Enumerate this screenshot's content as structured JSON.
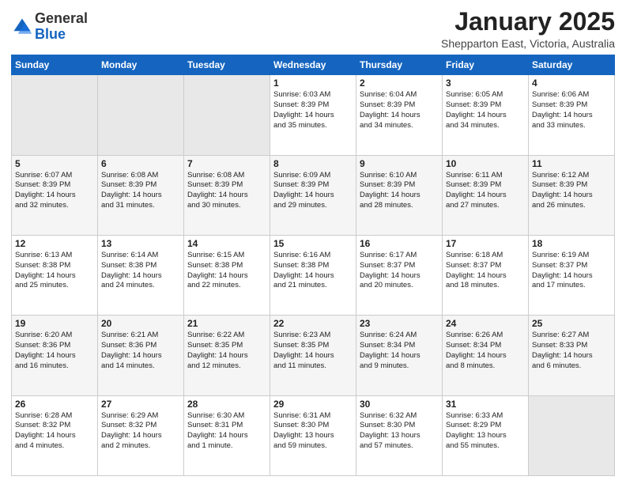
{
  "logo": {
    "general": "General",
    "blue": "Blue"
  },
  "header": {
    "month": "January 2025",
    "location": "Shepparton East, Victoria, Australia"
  },
  "days_of_week": [
    "Sunday",
    "Monday",
    "Tuesday",
    "Wednesday",
    "Thursday",
    "Friday",
    "Saturday"
  ],
  "weeks": [
    [
      {
        "day": "",
        "info": ""
      },
      {
        "day": "",
        "info": ""
      },
      {
        "day": "",
        "info": ""
      },
      {
        "day": "1",
        "info": "Sunrise: 6:03 AM\nSunset: 8:39 PM\nDaylight: 14 hours\nand 35 minutes."
      },
      {
        "day": "2",
        "info": "Sunrise: 6:04 AM\nSunset: 8:39 PM\nDaylight: 14 hours\nand 34 minutes."
      },
      {
        "day": "3",
        "info": "Sunrise: 6:05 AM\nSunset: 8:39 PM\nDaylight: 14 hours\nand 34 minutes."
      },
      {
        "day": "4",
        "info": "Sunrise: 6:06 AM\nSunset: 8:39 PM\nDaylight: 14 hours\nand 33 minutes."
      }
    ],
    [
      {
        "day": "5",
        "info": "Sunrise: 6:07 AM\nSunset: 8:39 PM\nDaylight: 14 hours\nand 32 minutes."
      },
      {
        "day": "6",
        "info": "Sunrise: 6:08 AM\nSunset: 8:39 PM\nDaylight: 14 hours\nand 31 minutes."
      },
      {
        "day": "7",
        "info": "Sunrise: 6:08 AM\nSunset: 8:39 PM\nDaylight: 14 hours\nand 30 minutes."
      },
      {
        "day": "8",
        "info": "Sunrise: 6:09 AM\nSunset: 8:39 PM\nDaylight: 14 hours\nand 29 minutes."
      },
      {
        "day": "9",
        "info": "Sunrise: 6:10 AM\nSunset: 8:39 PM\nDaylight: 14 hours\nand 28 minutes."
      },
      {
        "day": "10",
        "info": "Sunrise: 6:11 AM\nSunset: 8:39 PM\nDaylight: 14 hours\nand 27 minutes."
      },
      {
        "day": "11",
        "info": "Sunrise: 6:12 AM\nSunset: 8:39 PM\nDaylight: 14 hours\nand 26 minutes."
      }
    ],
    [
      {
        "day": "12",
        "info": "Sunrise: 6:13 AM\nSunset: 8:38 PM\nDaylight: 14 hours\nand 25 minutes."
      },
      {
        "day": "13",
        "info": "Sunrise: 6:14 AM\nSunset: 8:38 PM\nDaylight: 14 hours\nand 24 minutes."
      },
      {
        "day": "14",
        "info": "Sunrise: 6:15 AM\nSunset: 8:38 PM\nDaylight: 14 hours\nand 22 minutes."
      },
      {
        "day": "15",
        "info": "Sunrise: 6:16 AM\nSunset: 8:38 PM\nDaylight: 14 hours\nand 21 minutes."
      },
      {
        "day": "16",
        "info": "Sunrise: 6:17 AM\nSunset: 8:37 PM\nDaylight: 14 hours\nand 20 minutes."
      },
      {
        "day": "17",
        "info": "Sunrise: 6:18 AM\nSunset: 8:37 PM\nDaylight: 14 hours\nand 18 minutes."
      },
      {
        "day": "18",
        "info": "Sunrise: 6:19 AM\nSunset: 8:37 PM\nDaylight: 14 hours\nand 17 minutes."
      }
    ],
    [
      {
        "day": "19",
        "info": "Sunrise: 6:20 AM\nSunset: 8:36 PM\nDaylight: 14 hours\nand 16 minutes."
      },
      {
        "day": "20",
        "info": "Sunrise: 6:21 AM\nSunset: 8:36 PM\nDaylight: 14 hours\nand 14 minutes."
      },
      {
        "day": "21",
        "info": "Sunrise: 6:22 AM\nSunset: 8:35 PM\nDaylight: 14 hours\nand 12 minutes."
      },
      {
        "day": "22",
        "info": "Sunrise: 6:23 AM\nSunset: 8:35 PM\nDaylight: 14 hours\nand 11 minutes."
      },
      {
        "day": "23",
        "info": "Sunrise: 6:24 AM\nSunset: 8:34 PM\nDaylight: 14 hours\nand 9 minutes."
      },
      {
        "day": "24",
        "info": "Sunrise: 6:26 AM\nSunset: 8:34 PM\nDaylight: 14 hours\nand 8 minutes."
      },
      {
        "day": "25",
        "info": "Sunrise: 6:27 AM\nSunset: 8:33 PM\nDaylight: 14 hours\nand 6 minutes."
      }
    ],
    [
      {
        "day": "26",
        "info": "Sunrise: 6:28 AM\nSunset: 8:32 PM\nDaylight: 14 hours\nand 4 minutes."
      },
      {
        "day": "27",
        "info": "Sunrise: 6:29 AM\nSunset: 8:32 PM\nDaylight: 14 hours\nand 2 minutes."
      },
      {
        "day": "28",
        "info": "Sunrise: 6:30 AM\nSunset: 8:31 PM\nDaylight: 14 hours\nand 1 minute."
      },
      {
        "day": "29",
        "info": "Sunrise: 6:31 AM\nSunset: 8:30 PM\nDaylight: 13 hours\nand 59 minutes."
      },
      {
        "day": "30",
        "info": "Sunrise: 6:32 AM\nSunset: 8:30 PM\nDaylight: 13 hours\nand 57 minutes."
      },
      {
        "day": "31",
        "info": "Sunrise: 6:33 AM\nSunset: 8:29 PM\nDaylight: 13 hours\nand 55 minutes."
      },
      {
        "day": "",
        "info": ""
      }
    ]
  ]
}
